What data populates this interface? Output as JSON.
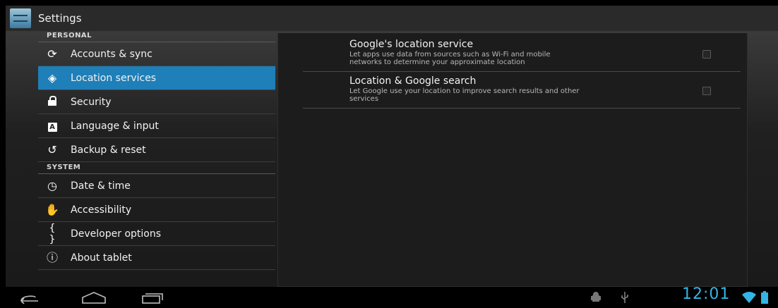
{
  "action_bar": {
    "title": "Settings"
  },
  "sidebar": {
    "sections": [
      {
        "header": "PERSONAL",
        "items": [
          {
            "label": "Accounts & sync",
            "icon": "sync-icon",
            "selected": false
          },
          {
            "label": "Location services",
            "icon": "location-icon",
            "selected": true
          },
          {
            "label": "Security",
            "icon": "lock-icon",
            "selected": false
          },
          {
            "label": "Language & input",
            "icon": "keyboard-a-icon",
            "selected": false
          },
          {
            "label": "Backup & reset",
            "icon": "backup-icon",
            "selected": false
          }
        ]
      },
      {
        "header": "SYSTEM",
        "items": [
          {
            "label": "Date & time",
            "icon": "clock-icon",
            "selected": false
          },
          {
            "label": "Accessibility",
            "icon": "hand-icon",
            "selected": false
          },
          {
            "label": "Developer options",
            "icon": "braces-icon",
            "selected": false
          },
          {
            "label": "About tablet",
            "icon": "info-icon",
            "selected": false
          }
        ]
      }
    ]
  },
  "main": {
    "preferences": [
      {
        "title": "Google's location service",
        "summary_line1": "Let apps use data from sources such as Wi-Fi and mobile",
        "summary_line2": "networks to determine your approximate location",
        "checked": false
      },
      {
        "title": "Location & Google search",
        "summary_line1": "Let Google use your location to improve search results and other",
        "summary_line2": "services",
        "checked": false
      }
    ]
  },
  "status_bar": {
    "time": "12:01"
  },
  "colors": {
    "accent": "#33b5e5",
    "selection": "#1f7fb8"
  }
}
